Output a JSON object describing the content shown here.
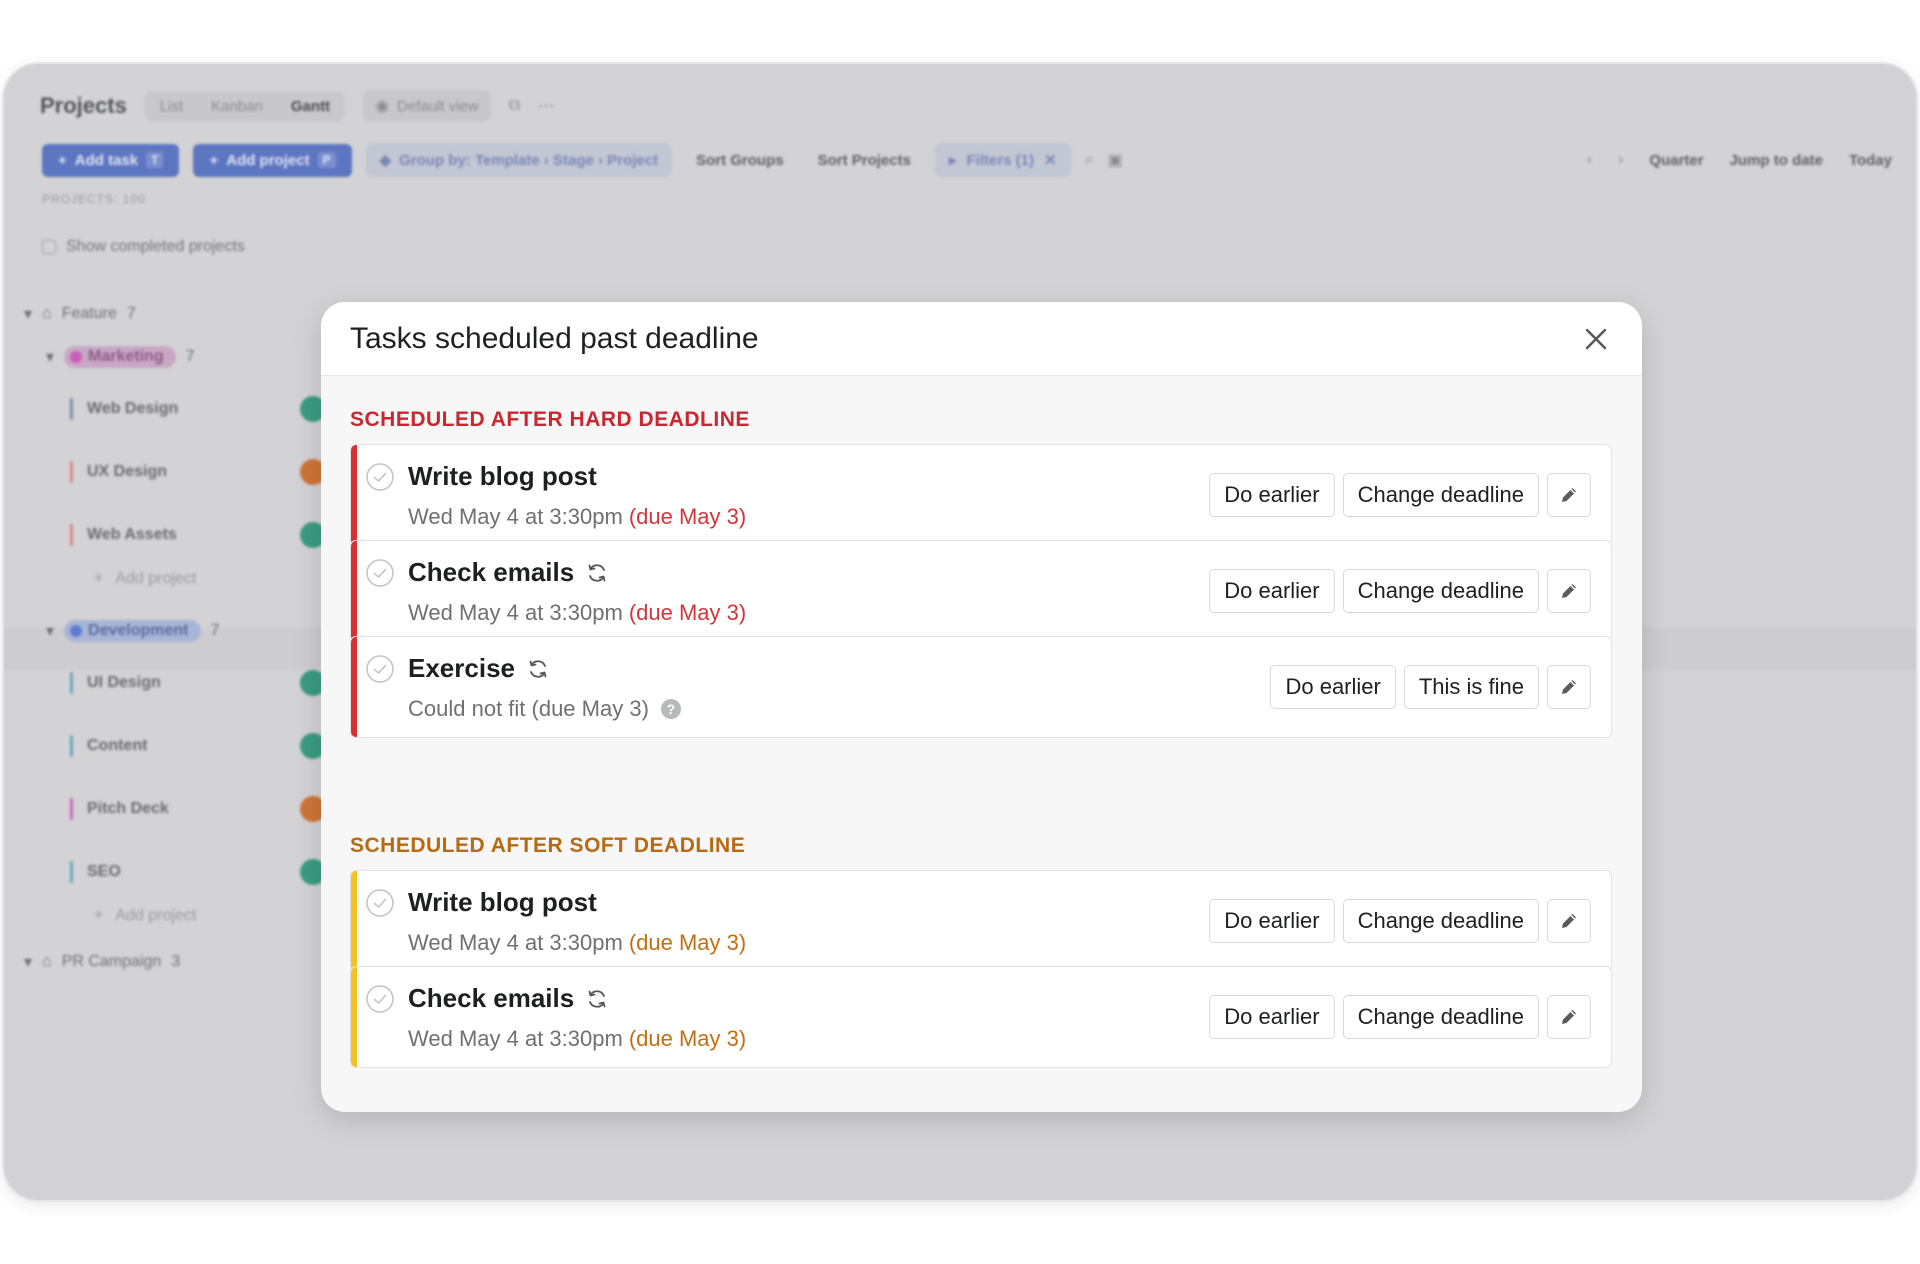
{
  "background": {
    "app_title": "Projects",
    "view_tabs": [
      "List",
      "Kanban",
      "Gantt"
    ],
    "default_view": "Default view",
    "toolbar": {
      "add_task": "Add task",
      "add_task_kbd": "T",
      "add_project": "Add project",
      "add_project_kbd": "P",
      "group_by": "Group by: Template › Stage › Project",
      "sort_groups": "Sort Groups",
      "sort_projects": "Sort Projects",
      "filters": "Filters (1)",
      "quarter": "Quarter",
      "jump_to_date": "Jump to date",
      "today": "Today"
    },
    "projects_count": "PROJECTS: 100",
    "show_completed": "Show completed projects",
    "groups": {
      "feature": {
        "label": "Feature",
        "count": "7"
      },
      "marketing": {
        "label": "Marketing",
        "count": "7"
      },
      "development": {
        "label": "Development",
        "count": "7"
      },
      "pr_campaign": {
        "label": "PR Campaign",
        "count": "3"
      }
    },
    "projects": [
      "Web Design",
      "UX Design",
      "Web Assets",
      "UI Design",
      "Content",
      "Pitch Deck",
      "SEO"
    ],
    "add_project_label": "Add project"
  },
  "modal": {
    "title": "Tasks scheduled past deadline",
    "hard_section": {
      "title": "SCHEDULED AFTER HARD DEADLINE",
      "tasks": [
        {
          "name": "Write blog post",
          "time": "Wed May 4 at 3:30pm",
          "due": "(due May 3)",
          "action1": "Do earlier",
          "action2": "Change deadline"
        },
        {
          "name": "Check emails",
          "time": "Wed May 4 at 3:30pm",
          "due": "(due May 3)",
          "action1": "Do earlier",
          "action2": "Change deadline"
        },
        {
          "name": "Exercise",
          "time": "Could not fit (due May 3)",
          "help": "?",
          "action1": "Do earlier",
          "action2": "This is fine"
        }
      ]
    },
    "soft_section": {
      "title": "SCHEDULED AFTER SOFT DEADLINE",
      "tasks": [
        {
          "name": "Write blog post",
          "time": "Wed May 4 at 3:30pm",
          "due": "(due May 3)",
          "action1": "Do earlier",
          "action2": "Change deadline"
        },
        {
          "name": "Check emails",
          "time": "Wed May 4 at 3:30pm",
          "due": "(due May 3)",
          "action1": "Do earlier",
          "action2": "Change deadline"
        }
      ]
    }
  },
  "colors": {
    "hard_accent": "#d72f34",
    "soft_accent": "#f6c11f",
    "hard_text": "#c8282f",
    "soft_text": "#b86a12"
  },
  "icons": {
    "close": "close-icon",
    "check": "check-circle-icon",
    "recurring": "recurring-icon",
    "edit": "pencil-icon",
    "help": "help-icon"
  }
}
